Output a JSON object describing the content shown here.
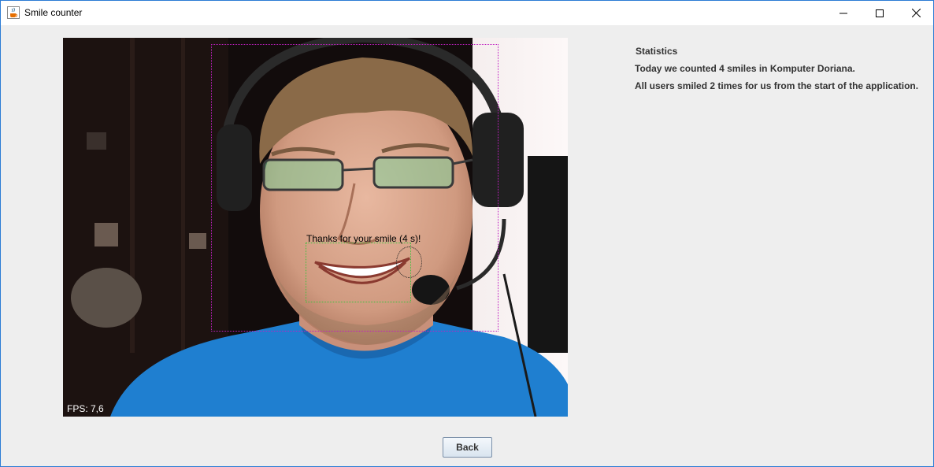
{
  "window": {
    "title": "Smile counter",
    "icon": "java-cup-icon"
  },
  "camera": {
    "overlay_message": "Thanks for your smile (4 s)!",
    "fps_label": "FPS: 7,6"
  },
  "statistics": {
    "heading": "Statistics",
    "today_line": "Today we counted 4 smiles in Komputer Doriana.",
    "total_line": "All users smiled 2 times for us from the start of the application."
  },
  "actions": {
    "back_label": "Back"
  },
  "colors": {
    "face_box": "#c020c0",
    "mouth_box": "#3dc23d",
    "window_border": "#2b7bd4"
  }
}
